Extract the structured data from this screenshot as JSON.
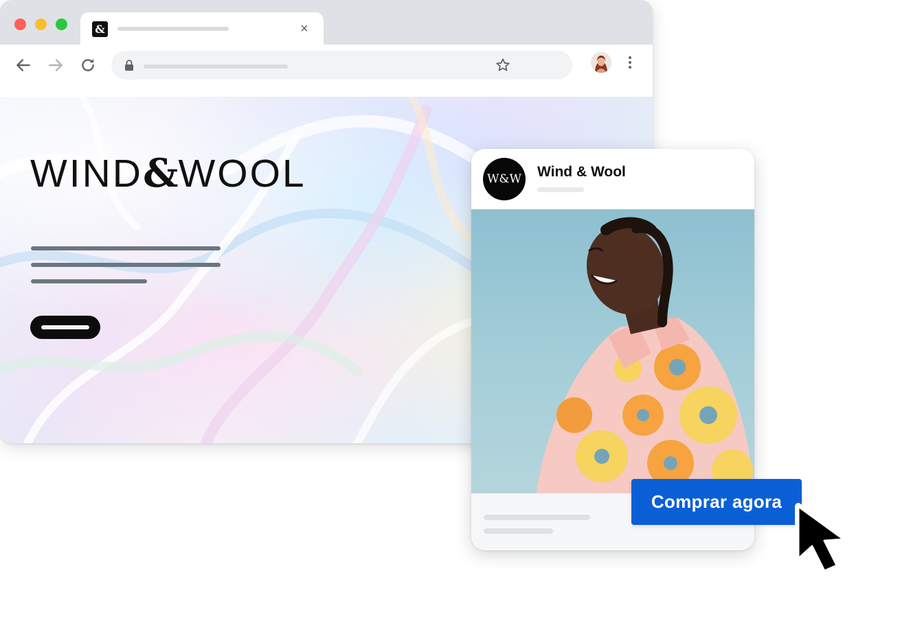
{
  "browser": {
    "tab": {
      "favicon": "&",
      "close_glyph": "×"
    },
    "icons": {
      "back": "arrow-back-icon",
      "forward": "arrow-forward-icon",
      "reload": "reload-icon",
      "lock": "lock-icon",
      "bookmark": "star-icon",
      "menu": "more-vert-icon"
    }
  },
  "landing": {
    "logo": {
      "left": "WIND",
      "amp": "&",
      "right": "WOOL"
    }
  },
  "ad": {
    "avatar_text": "W&W",
    "name": "Wind & Wool",
    "cta_label": "Comprar agora"
  },
  "colors": {
    "cta_blue": "#0b5fd6",
    "tab_strip": "#dee1e6",
    "omnibox": "#f1f3f4",
    "traffic_red": "#fe5f57",
    "traffic_yellow": "#febc2e",
    "traffic_green": "#28c840"
  }
}
